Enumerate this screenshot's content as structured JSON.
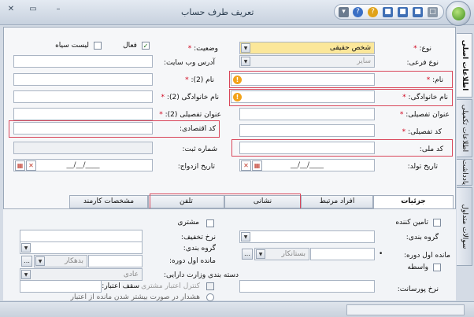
{
  "window": {
    "title": "تعریف طرف حساب",
    "close": "✕",
    "maximize": "▭",
    "minimize": "–"
  },
  "quick_icons": [
    {
      "name": "dropdown-icon",
      "glyph": "▾",
      "color": "#6b7b8f"
    },
    {
      "name": "help-blue-icon",
      "glyph": "?",
      "color": "#3a6fc4"
    },
    {
      "name": "help-gold-icon",
      "glyph": "?",
      "color": "#e0a31a"
    },
    {
      "name": "save-icon",
      "glyph": "■",
      "color": "#3f6fb5"
    },
    {
      "name": "save-all-icon",
      "glyph": "■",
      "color": "#3f6fb5"
    },
    {
      "name": "open-icon",
      "glyph": "■",
      "color": "#3f6fb5"
    },
    {
      "name": "new-icon",
      "glyph": "□",
      "color": "#8a98a8"
    }
  ],
  "side_tabs": [
    "اطلاعات اصلی",
    "اطلاعات تکمیلی",
    "یادداشت",
    "سوالات متداول"
  ],
  "right": {
    "type_label": "نوع:",
    "type_value": "شخص حقیقی",
    "subtype_label": "نوع فرعی:",
    "subtype_value": "سایر",
    "first_name_label": "نام:",
    "last_name_label": "نام خانوادگی:",
    "title_label": "عنوان تفصیلی:",
    "detail_code_label": "کد تفصیلی:",
    "national_code_label": "کد ملی:",
    "birth_label": "تاریخ تولد:",
    "birth_value": "__/__/____"
  },
  "left": {
    "status_label": "وضعیت:",
    "active_label": "فعال",
    "blacklist_label": "لیست سیاه",
    "website_label": "آدرس وب سایت:",
    "name2_label": "نام (2):",
    "last2_label": "نام خانوادگی (2):",
    "title2_label": "عنوان تفصیلی (2):",
    "eco_label": "کد اقتصادی:",
    "reg_label": "شماره ثبت:",
    "marriage_label": "تاریخ ازدواج:",
    "marriage_value": "__/__/____"
  },
  "tabs": [
    "جزئیات",
    "افراد مرتبط",
    "نشانی",
    "تلفن",
    "مشخصات کارمند"
  ],
  "panel": {
    "supplier_label": "تامین کننده",
    "group_label": "گروه بندی:",
    "opening_label": "مانده اول دوره:",
    "opening_value": "بستانکار",
    "broker_label": "واسطه",
    "commission_label": "نرخ پورسانت:",
    "customer_label": "مشتری",
    "discount_label": "نرخ تخفیف:",
    "group2_label": "گروه بندی:",
    "opening2_label": "مانده اول دوره:",
    "opening2_value": "بدهکار",
    "finance_label": "دسته بندی وزارت دارایی:",
    "finance_value": "عادی",
    "credit_ctrl_label": "کنترل اعتبار مشتری",
    "credit_cap_label": "سقف اعتبار:",
    "warn_text": "هشدار در صورت بیشتر شدن مانده از اعتبار"
  }
}
